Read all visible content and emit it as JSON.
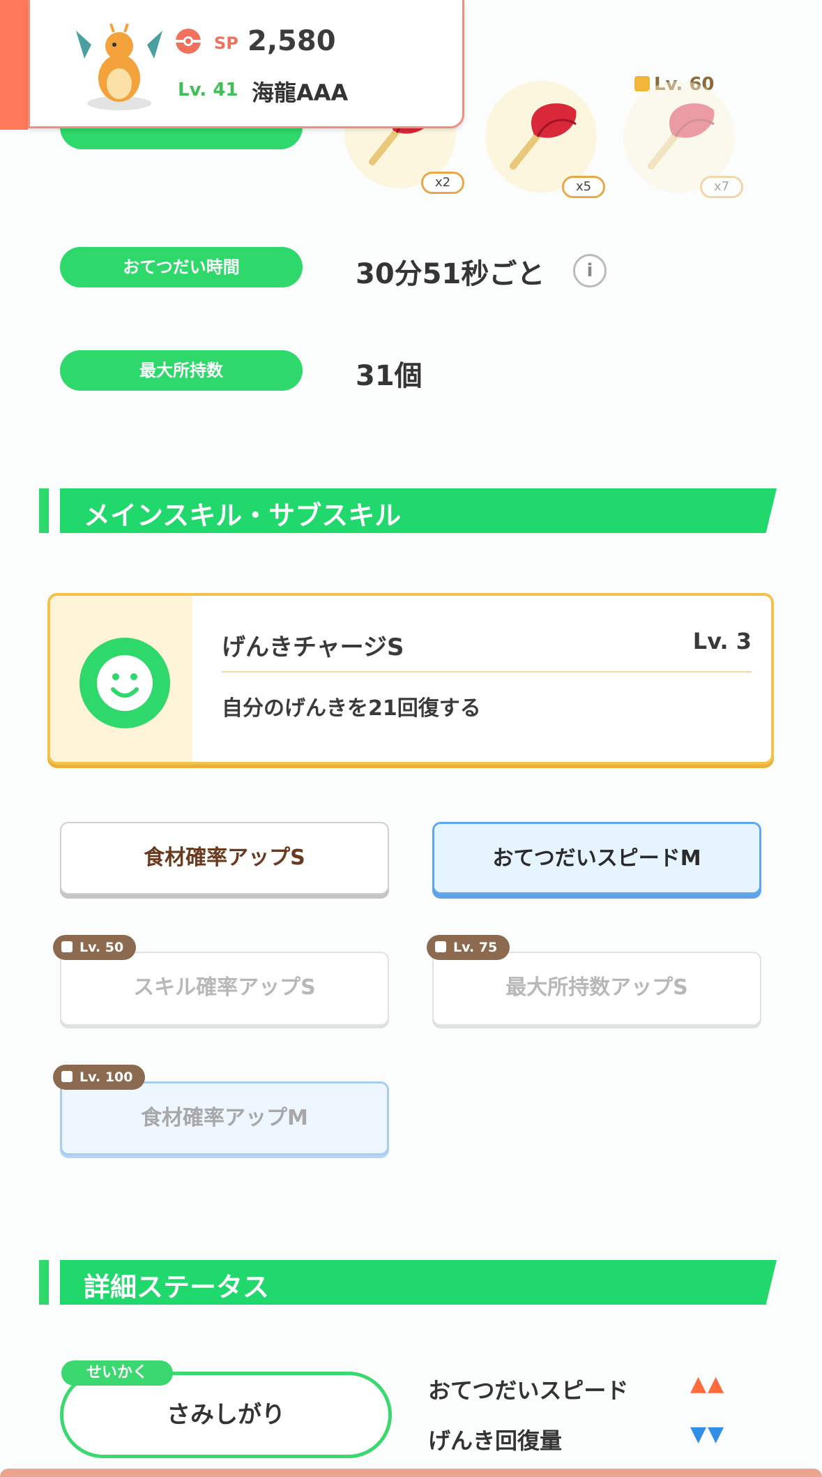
{
  "header": {
    "sp_label": "SP",
    "sp_value": "2,580",
    "level": "Lv. 41",
    "nickname": "海龍AAA"
  },
  "ingredients": {
    "items": [
      {
        "qty": "x2",
        "locked": false
      },
      {
        "qty": "x5",
        "locked": false
      },
      {
        "qty": "x7",
        "locked": true,
        "unlock_level": "Lv. 60"
      }
    ]
  },
  "stats": {
    "help_time_label": "おてつだい時間",
    "help_time_value": "30分51秒ごと",
    "max_carry_label": "最大所持数",
    "max_carry_value": "31個"
  },
  "skills_section": {
    "title": "メインスキル・サブスキル",
    "main_skill": {
      "name": "げんきチャージS",
      "level": "Lv. 3",
      "description": "自分のげんきを21回復する"
    },
    "sub_skills": [
      {
        "label": "食材確率アップS",
        "locked": false
      },
      {
        "label": "おてつだいスピードM",
        "locked": false
      },
      {
        "label": "スキル確率アップS",
        "locked": true,
        "unlock_level": "Lv. 50"
      },
      {
        "label": "最大所持数アップS",
        "locked": true,
        "unlock_level": "Lv. 75"
      },
      {
        "label": "食材確率アップM",
        "locked": true,
        "unlock_level": "Lv. 100"
      }
    ]
  },
  "detail_section": {
    "title": "詳細ステータス",
    "nature_tag": "せいかく",
    "nature_value": "さみしがり",
    "effects": [
      {
        "label": "おてつだいスピード",
        "arrows": "▲▲",
        "direction": "up"
      },
      {
        "label": "げんき回復量",
        "arrows": "▼▼",
        "direction": "down"
      }
    ]
  },
  "colors": {
    "accent_green": "#2ed86a",
    "sp_orange": "#f0725c",
    "up_arrow": "#ff6b3d",
    "down_arrow": "#2f8ee6",
    "skill_card_border": "#f2c24a"
  }
}
